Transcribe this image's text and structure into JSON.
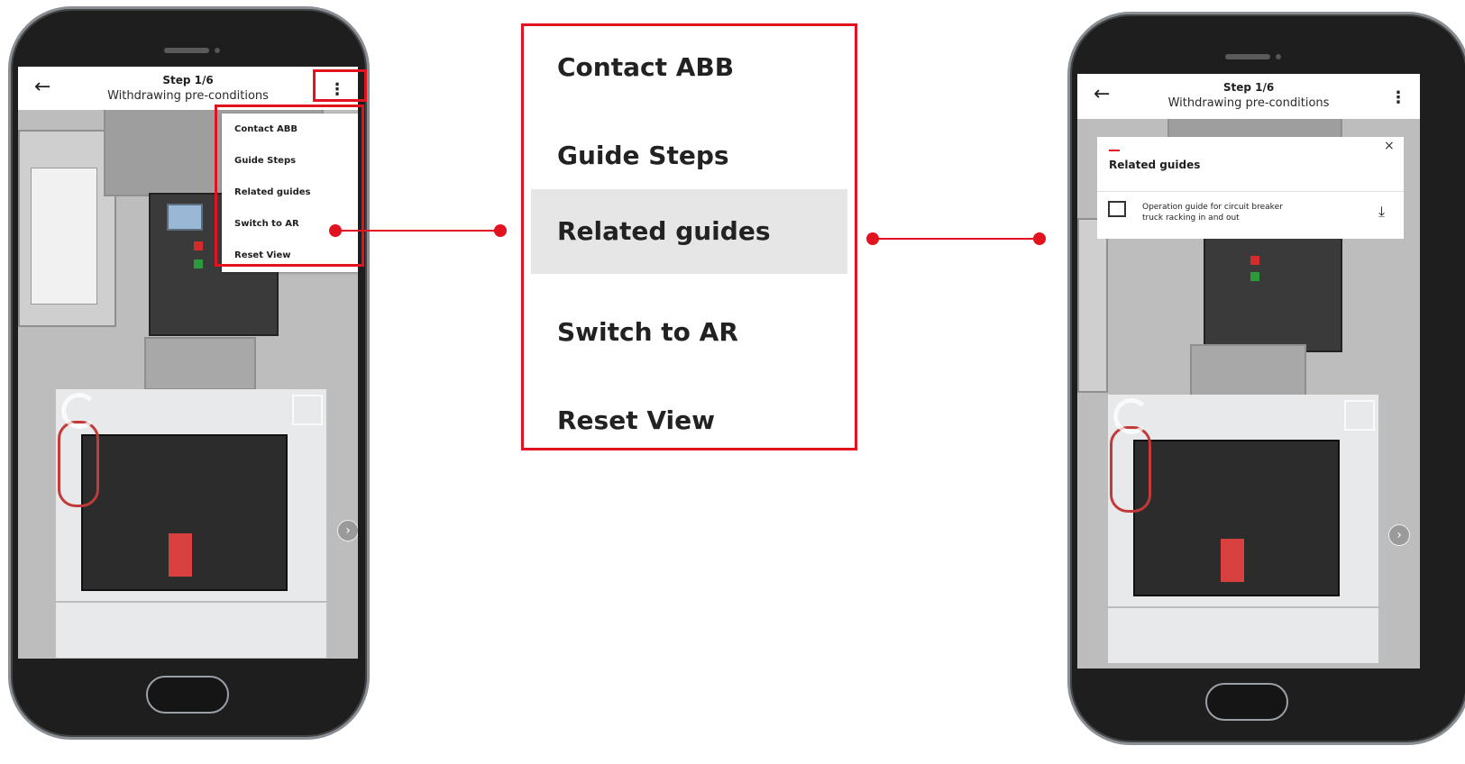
{
  "appbar": {
    "step_label": "Step 1/6",
    "step_title": "Withdrawing pre-conditions"
  },
  "icons": {
    "back": "←",
    "menu": "⋮",
    "close": "×",
    "download": "⤓",
    "next": "›"
  },
  "menu": {
    "items": [
      "Contact ABB",
      "Guide Steps",
      "Related guides",
      "Switch to AR",
      "Reset View"
    ],
    "selected": "Related guides"
  },
  "related_guides": {
    "title": "Related guides",
    "items": [
      {
        "line1": "Operation guide for circuit breaker",
        "line2": "truck racking in and out"
      }
    ]
  },
  "colors": {
    "accent_red": "#e3121f",
    "menu_highlight": "#e6e6e6"
  }
}
